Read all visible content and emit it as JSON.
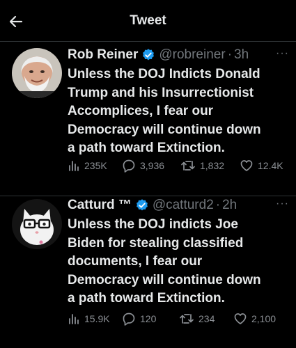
{
  "header": {
    "title": "Tweet",
    "back_icon": "back-arrow-icon"
  },
  "tweets": [
    {
      "name": "Rob Reiner",
      "verified": true,
      "handle": "@robreiner",
      "sep": "·",
      "time": "3h",
      "more": "···",
      "text": "Unless the DOJ Indicts Donald\nTrump and his Insurrectionist\nAccomplices, I fear our\nDemocracy will continue down\na path toward Extinction.",
      "stats": {
        "views": "235K",
        "replies": "3,936",
        "retweets": "1,832",
        "likes": "12.4K"
      }
    },
    {
      "name": "Catturd ™",
      "verified": true,
      "handle": "@catturd2",
      "sep": "·",
      "time": "2h",
      "more": "···",
      "text": "Unless the DOJ indicts Joe\nBiden for stealing classified\ndocuments, I fear our\nDemocracy will continue down\na path toward Extinction.",
      "stats": {
        "views": "15.9K",
        "replies": "120",
        "retweets": "234",
        "likes": "2,100"
      }
    }
  ],
  "colors": {
    "background": "#000000",
    "text": "#e7e9ea",
    "muted": "#71767b",
    "verified": "#1d9bf0",
    "divider": "#2f3336"
  }
}
